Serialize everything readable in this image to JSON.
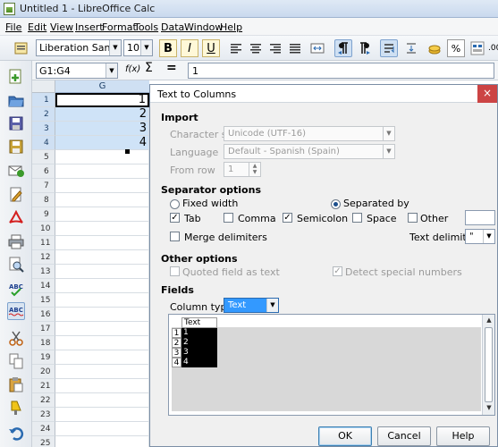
{
  "window": {
    "title": "Untitled 1 - LibreOffice Calc"
  },
  "menu": [
    "File",
    "Edit",
    "View",
    "Insert",
    "Format",
    "Tools",
    "Data",
    "Window",
    "Help"
  ],
  "toolbar": {
    "font_name": "Liberation Sans",
    "font_size": "10",
    "bold": "B",
    "italic": "I",
    "underline": "U",
    "percent": "%",
    "decimal": ".00"
  },
  "formula_bar": {
    "name_box": "G1:G4",
    "content": "1"
  },
  "sheet": {
    "column": "G",
    "rows": [
      {
        "num": "1",
        "value": "1"
      },
      {
        "num": "2",
        "value": "2"
      },
      {
        "num": "3",
        "value": "3"
      },
      {
        "num": "4",
        "value": "4"
      },
      {
        "num": "5",
        "value": ""
      },
      {
        "num": "6",
        "value": ""
      },
      {
        "num": "7",
        "value": ""
      },
      {
        "num": "8",
        "value": ""
      },
      {
        "num": "9",
        "value": ""
      },
      {
        "num": "10",
        "value": ""
      },
      {
        "num": "11",
        "value": ""
      },
      {
        "num": "12",
        "value": ""
      },
      {
        "num": "13",
        "value": ""
      },
      {
        "num": "14",
        "value": ""
      },
      {
        "num": "15",
        "value": ""
      },
      {
        "num": "16",
        "value": ""
      },
      {
        "num": "17",
        "value": ""
      },
      {
        "num": "18",
        "value": ""
      },
      {
        "num": "19",
        "value": ""
      },
      {
        "num": "20",
        "value": ""
      },
      {
        "num": "21",
        "value": ""
      },
      {
        "num": "22",
        "value": ""
      },
      {
        "num": "23",
        "value": ""
      },
      {
        "num": "24",
        "value": ""
      },
      {
        "num": "25",
        "value": ""
      }
    ]
  },
  "dialog": {
    "title": "Text to Columns",
    "close": "×",
    "import": {
      "heading": "Import",
      "charset_label": "Character set",
      "charset_value": "Unicode (UTF-16)",
      "language_label": "Language",
      "language_value": "Default - Spanish (Spain)",
      "from_row_label": "From row",
      "from_row_value": "1"
    },
    "separator": {
      "heading": "Separator options",
      "fixed_width": "Fixed width",
      "separated_by": "Separated by",
      "tab": "Tab",
      "comma": "Comma",
      "semicolon": "Semicolon",
      "space": "Space",
      "other": "Other",
      "merge": "Merge delimiters",
      "text_delimiter_label": "Text delimiter",
      "text_delimiter_value": "\""
    },
    "other_options": {
      "heading": "Other options",
      "quoted": "Quoted field as text",
      "detect": "Detect special numbers"
    },
    "fields": {
      "heading": "Fields",
      "column_type_label": "Column type",
      "column_type_value": "Text",
      "preview_header": "Text",
      "preview_rows": [
        {
          "num": "1",
          "value": "1"
        },
        {
          "num": "2",
          "value": "2"
        },
        {
          "num": "3",
          "value": "3"
        },
        {
          "num": "4",
          "value": "4"
        }
      ]
    },
    "buttons": {
      "ok": "OK",
      "cancel": "Cancel",
      "help": "Help"
    }
  }
}
